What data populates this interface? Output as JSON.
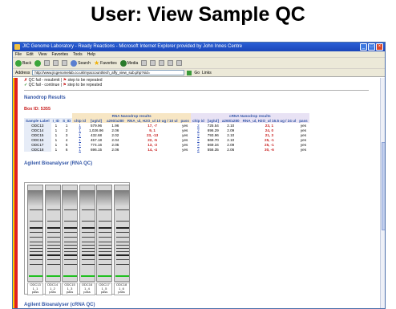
{
  "slide": {
    "title": "User: View Sample QC"
  },
  "window": {
    "title": "JIC Genome Laboratory - Ready Reactions - Microsoft Internet Explorer provided by John Innes Centre",
    "menu": [
      "File",
      "Edit",
      "View",
      "Favorites",
      "Tools",
      "Help"
    ],
    "toolbar": {
      "back": "Back",
      "search": "Search",
      "favorites": "Favorites",
      "media": "Media"
    },
    "address_label": "Address",
    "address_value": "http://www.jicgenomelab.co.uk/myaccount/tech_affy_view_sub.php?sid=",
    "go": "Go",
    "links": "Links"
  },
  "notes": {
    "line1_label": "QC fail - resubmit",
    "line1_warn": "step to be repeated",
    "line2_label": "QC fail - continue",
    "line2_warn": "step to be repeated"
  },
  "section_title": "Nanodrop Results",
  "box_id": "Box ID: 5355",
  "table": {
    "group1": "RNA Nanodrop results",
    "group2": "cRNA Nanodrop results",
    "columns": [
      "Sample Label",
      "I_ID",
      "S_ID",
      "chip id",
      "[ug/ul]",
      "a260/a280",
      "RNA_ul, H2O_ul 10 ug / 10 ul",
      "pass",
      "chip id",
      "[ug/ul]",
      "a260/a280",
      "RNA_ul, H2O_ul 16.5 ug / 24 ul",
      "pass"
    ],
    "rows": [
      [
        "ODC13",
        "1",
        "1",
        "1",
        "579.96",
        "1.96",
        "17, -7",
        "yes",
        "2",
        "725.54",
        "2.10",
        "23, 1",
        "yes"
      ],
      [
        "ODC14",
        "1",
        "2",
        "1",
        "1,026.96",
        "2.06",
        "9, 1",
        "yes",
        "2",
        "696.29",
        "2.09",
        "24, 0",
        "yes"
      ],
      [
        "ODC15",
        "1",
        "3",
        "1",
        "432.68",
        "2.02",
        "23, -13",
        "yes",
        "2",
        "793.96",
        "2.10",
        "21, 3",
        "yes"
      ],
      [
        "ODC16",
        "1",
        "4",
        "1",
        "457.18",
        "2.04",
        "22, -5",
        "yes",
        "2",
        "669.70",
        "2.10",
        "25, -1",
        "yes"
      ],
      [
        "ODC17",
        "1",
        "5",
        "1",
        "774.16",
        "2.05",
        "13, -3",
        "yes",
        "2",
        "669.34",
        "2.09",
        "25, -1",
        "yes"
      ],
      [
        "ODC18",
        "1",
        "6",
        "1",
        "696.15",
        "2.06",
        "14, -4",
        "yes",
        "2",
        "556.35",
        "2.06",
        "30, -6",
        "yes"
      ]
    ]
  },
  "bioanalyser_rna": "Agilent Bioanalyser (RNA QC)",
  "lanes": [
    {
      "label": "ODC13",
      "sub": "1_1",
      "status": "pass"
    },
    {
      "label": "ODC14",
      "sub": "1_2",
      "status": "pass"
    },
    {
      "label": "ODC15",
      "sub": "1_3",
      "status": "pass"
    },
    {
      "label": "ODC16",
      "sub": "1_4",
      "status": "pass"
    },
    {
      "label": "ODC17",
      "sub": "1_5",
      "status": "pass"
    },
    {
      "label": "ODC18",
      "sub": "1_6",
      "status": "pass"
    }
  ],
  "bioanalyser_crna": "Agilent Bioanalyser (cRNA QC)",
  "colors": {
    "accent_blue": "#3558a8",
    "warn_red": "#c81e1e",
    "side_yellow": "#ffcc00",
    "side_red": "#e0201f"
  }
}
